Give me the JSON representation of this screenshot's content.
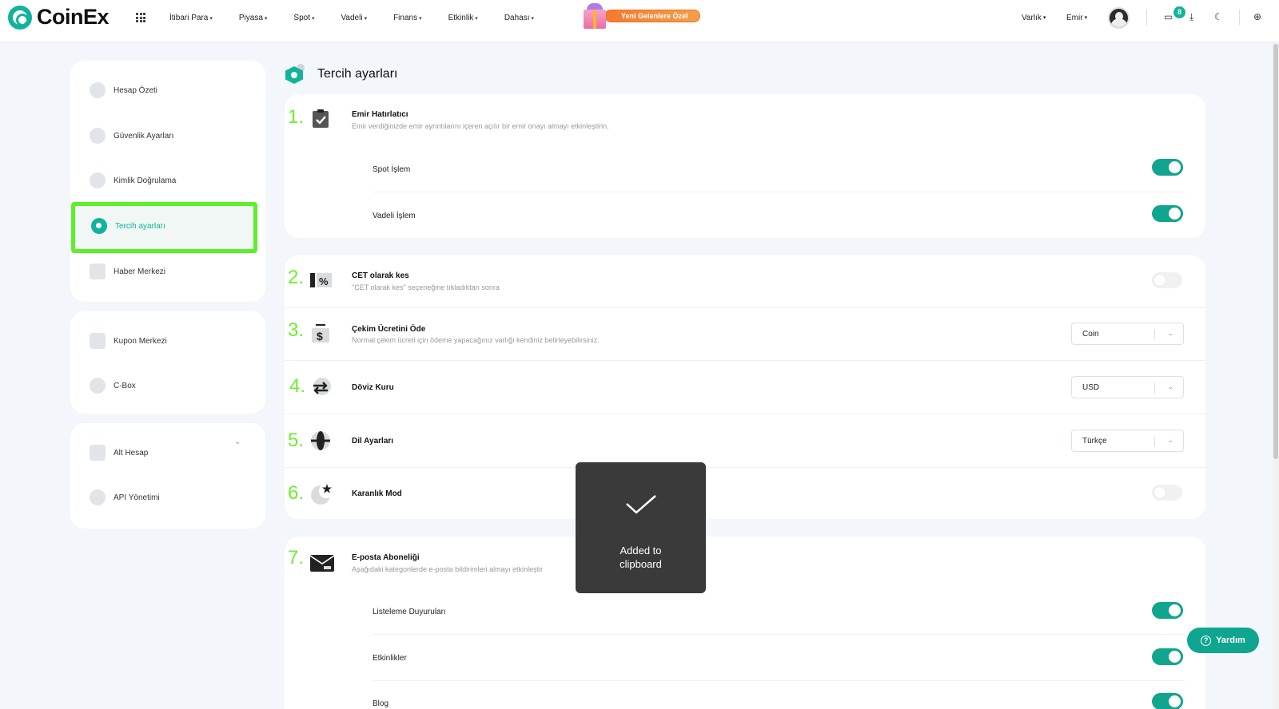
{
  "brand": {
    "name": "CoinEx"
  },
  "nav": {
    "items": [
      "İtibari Para",
      "Piyasa",
      "Spot",
      "Vadeli",
      "Finans",
      "Etkinlik",
      "Dahası"
    ],
    "promo": "Yeni Gelenlere Özel",
    "right": [
      "Varlık",
      "Emir"
    ],
    "notif_count": "8"
  },
  "sidebar": {
    "group1": [
      "Hesap Özeti",
      "Güvenlik Ayarları",
      "Kimlik Doğrulama",
      "Tercih ayarları",
      "Haber Merkezi"
    ],
    "group2": [
      "Kupon Merkezi",
      "C-Box"
    ],
    "group3": [
      "Alt Hesap",
      "API Yönetimi"
    ],
    "active": "Tercih ayarları"
  },
  "page": {
    "title": "Tercih ayarları"
  },
  "settings": {
    "s1": {
      "num": "1.",
      "title": "Emir Hatırlatıcı",
      "desc": "Emir verdiğinizde emir ayrıntılarını içeren açılır bir emir onayı almayı etkinleştirin.",
      "sub": [
        {
          "label": "Spot İşlem",
          "on": true
        },
        {
          "label": "Vadeli İşlem",
          "on": true
        }
      ]
    },
    "s2": {
      "num": "2.",
      "title": "CET olarak kes",
      "desc": "\"CET olarak kes\" seçeneğine tıkladıktan sonra",
      "on": false
    },
    "s3": {
      "num": "3.",
      "title": "Çekim Ücretini Öde",
      "desc": "Normal çekim ücreti için ödeme yapacağınız varlığı kendiniz belirleyebilirsiniz.",
      "value": "Coin"
    },
    "s4": {
      "num": "4.",
      "title": "Döviz Kuru",
      "value": "USD"
    },
    "s5": {
      "num": "5.",
      "title": "Dil Ayarları",
      "value": "Türkçe"
    },
    "s6": {
      "num": "6.",
      "title": "Karanlık Mod",
      "on": false
    },
    "s7": {
      "num": "7.",
      "title": "E-posta Aboneliği",
      "desc": "Aşağıdaki kategorilerde e-posta bildirimleri almayı etkinleştir",
      "sub": [
        {
          "label": "Listeleme Duyuruları",
          "on": true
        },
        {
          "label": "Etkinlikler",
          "on": true
        },
        {
          "label": "Blog",
          "on": true
        }
      ]
    }
  },
  "toast": {
    "message": "Added to clipboard"
  },
  "help": {
    "label": "Yardım"
  },
  "colors": {
    "accent": "#10b39b",
    "annotation": "#6bf02b",
    "toast_bg": "#3a3a3a"
  }
}
